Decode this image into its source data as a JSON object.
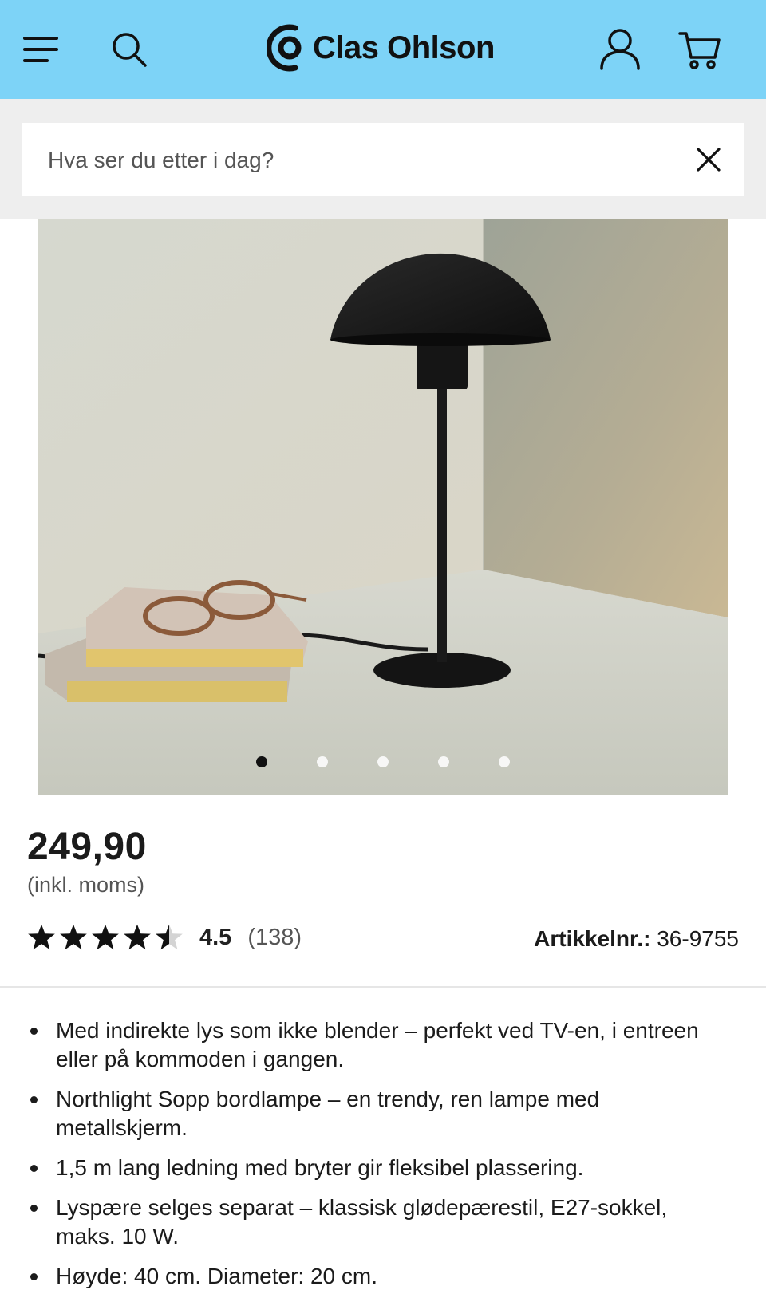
{
  "brand": {
    "name": "Clas Ohlson",
    "header_color": "#7dd3f7"
  },
  "header": {
    "menu_icon": "hamburger-menu-icon",
    "search_icon": "search-icon",
    "account_icon": "user-account-icon",
    "cart_icon": "shopping-cart-icon"
  },
  "search": {
    "placeholder": "Hva ser du etter i dag?",
    "value": "",
    "clear_icon": "close-icon"
  },
  "gallery": {
    "image_count": 5,
    "active_index": 0
  },
  "product": {
    "price": "249,90",
    "vat_note": "(inkl. moms)",
    "rating": {
      "value": "4.5",
      "stars": 4.5,
      "max": 5,
      "count": "(138)"
    },
    "article_label": "Artikkelnr.:",
    "article_number": "36-9755",
    "features": [
      "Med indirekte lys som ikke blender – perfekt ved TV-en, i entreen eller på kommoden i gangen.",
      "Northlight Sopp bordlampe – en trendy, ren lampe med metallskjerm.",
      "1,5 m lang ledning med bryter gir fleksibel plassering.",
      "Lyspære selges separat – klassisk glødepærestil, E27-sokkel, maks. 10 W.",
      "Høyde: 40 cm. Diameter: 20 cm."
    ]
  }
}
